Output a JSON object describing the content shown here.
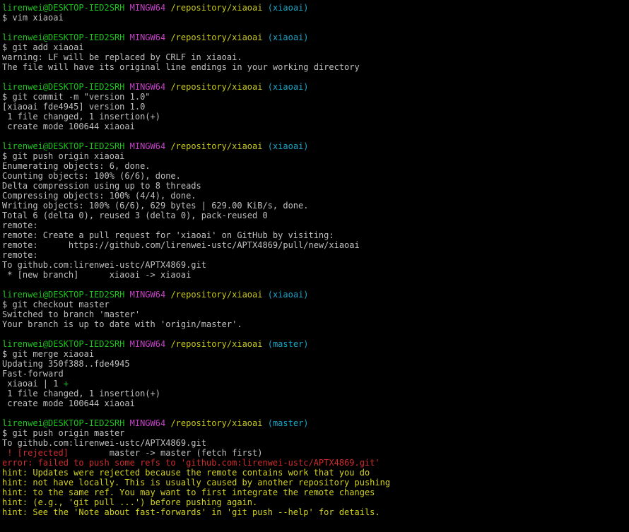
{
  "colors": {
    "background": "#000000",
    "text": "#c0c0c0",
    "user": "#1cc41c",
    "env": "#c640c6",
    "path": "#c8c81c",
    "branch": "#1aa5c8",
    "error": "#d12c2c",
    "hint": "#d2d21e"
  },
  "prompt": {
    "user_host": "lirenwei@DESKTOP-IED2SRH",
    "env": "MINGW64",
    "path": "/repository/xiaoai",
    "branch_xiaoai": "(xiaoai)",
    "branch_master": "(master)"
  },
  "blocks": [
    {
      "command": "$ vim xiaoai",
      "output": []
    },
    {
      "command": "$ git add xiaoai",
      "output": [
        "warning: LF will be replaced by CRLF in xiaoai.",
        "The file will have its original line endings in your working directory"
      ]
    },
    {
      "command": "$ git commit -m \"version 1.0\"",
      "output": [
        "[xiaoai fde4945] version 1.0",
        " 1 file changed, 1 insertion(+)",
        " create mode 100644 xiaoai"
      ]
    },
    {
      "command": "$ git push origin xiaoai",
      "output": [
        "Enumerating objects: 6, done.",
        "Counting objects: 100% (6/6), done.",
        "Delta compression using up to 8 threads",
        "Compressing objects: 100% (4/4), done.",
        "Writing objects: 100% (6/6), 629 bytes | 629.00 KiB/s, done.",
        "Total 6 (delta 0), reused 3 (delta 0), pack-reused 0",
        "remote:",
        "remote: Create a pull request for 'xiaoai' on GitHub by visiting:",
        "remote:      https://github.com/lirenwei-ustc/APTX4869/pull/new/xiaoai",
        "remote:",
        "To github.com:lirenwei-ustc/APTX4869.git",
        " * [new branch]      xiaoai -> xiaoai"
      ]
    },
    {
      "command": "$ git checkout master",
      "output": [
        "Switched to branch 'master'",
        "Your branch is up to date with 'origin/master'."
      ]
    },
    {
      "command": "$ git merge xiaoai",
      "output": [
        "Updating 350f388..fde4945",
        "Fast-forward"
      ],
      "stat_file": " xiaoai | 1 ",
      "stat_plus": "+",
      "output_after": [
        " 1 file changed, 1 insertion(+)",
        " create mode 100644 xiaoai"
      ]
    },
    {
      "command": "$ git push origin master",
      "output": [
        "To github.com:lirenwei-ustc/APTX4869.git"
      ],
      "rejected_tag": " ! [rejected]",
      "rejected_rest": "        master -> master (fetch first)",
      "error_line": "error: failed to push some refs to 'github.com:lirenwei-ustc/APTX4869.git'",
      "hints": [
        "hint: Updates were rejected because the remote contains work that you do",
        "hint: not have locally. This is usually caused by another repository pushing",
        "hint: to the same ref. You may want to first integrate the remote changes",
        "hint: (e.g., 'git pull ...') before pushing again.",
        "hint: See the 'Note about fast-forwards' in 'git push --help' for details."
      ]
    }
  ]
}
